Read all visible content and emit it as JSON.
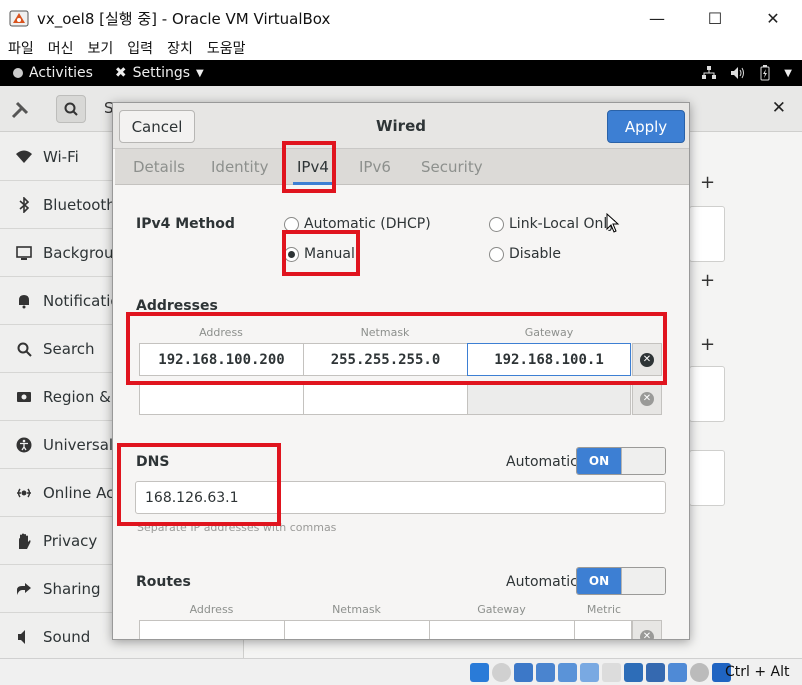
{
  "window": {
    "title": "vx_oel8 [실행 중] - Oracle VM VirtualBox",
    "menu": [
      "파일",
      "머신",
      "보기",
      "입력",
      "장치",
      "도움말"
    ]
  },
  "gnome_bar": {
    "activities": "Activities",
    "app_menu": "Settings"
  },
  "settings": {
    "header_truncated": "S",
    "sidebar": [
      {
        "label": "Wi-Fi",
        "icon": "wifi-icon"
      },
      {
        "label": "Bluetooth",
        "icon": "bluetooth-icon"
      },
      {
        "label": "Background",
        "icon": "background-icon"
      },
      {
        "label": "Notification",
        "icon": "notifications-icon"
      },
      {
        "label": "Search",
        "icon": "search-icon"
      },
      {
        "label": "Region & L",
        "icon": "region-icon"
      },
      {
        "label": "Universal A",
        "icon": "accessibility-icon"
      },
      {
        "label": "Online Acc",
        "icon": "online-accounts-icon"
      },
      {
        "label": "Privacy",
        "icon": "privacy-icon"
      },
      {
        "label": "Sharing",
        "icon": "sharing-icon"
      },
      {
        "label": "Sound",
        "icon": "sound-icon"
      }
    ]
  },
  "dialog": {
    "cancel": "Cancel",
    "title": "Wired",
    "apply": "Apply",
    "tabs": [
      "Details",
      "Identity",
      "IPv4",
      "IPv6",
      "Security"
    ],
    "active_tab": "IPv4",
    "method_label": "IPv4 Method",
    "methods": {
      "automatic": "Automatic (DHCP)",
      "link_local": "Link-Local Only",
      "manual": "Manual",
      "disable": "Disable"
    },
    "selected_method": "Manual",
    "addresses": {
      "title": "Addresses",
      "headers": [
        "Address",
        "Netmask",
        "Gateway"
      ],
      "rows": [
        {
          "address": "192.168.100.200",
          "netmask": "255.255.255.0",
          "gateway": "192.168.100.1"
        }
      ]
    },
    "dns": {
      "title": "DNS",
      "automatic_label": "Automatic",
      "toggle": "ON",
      "value": "168.126.63.1",
      "hint": "Separate IP addresses with commas"
    },
    "routes": {
      "title": "Routes",
      "automatic_label": "Automatic",
      "toggle": "ON",
      "headers": [
        "Address",
        "Netmask",
        "Gateway",
        "Metric"
      ]
    }
  },
  "status_bar": {
    "host_key": "Ctrl + Alt"
  },
  "colors": {
    "accent": "#3d7fd3",
    "highlight": "#e0141e"
  }
}
